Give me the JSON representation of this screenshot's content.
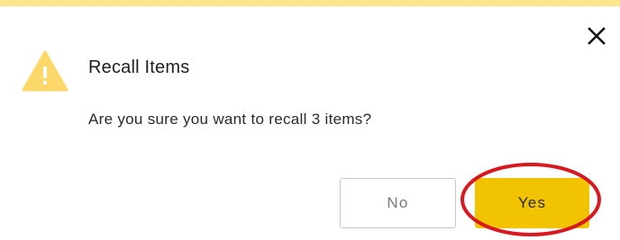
{
  "dialog": {
    "title": "Recall Items",
    "message": "Are you sure you want to recall 3 items?",
    "buttons": {
      "no_label": "No",
      "yes_label": "Yes"
    },
    "icons": {
      "close": "close-icon",
      "warning": "warning-icon"
    },
    "colors": {
      "top_bar": "#fce68a",
      "warning": "#fcd86a",
      "primary_button": "#f2c300",
      "highlight": "#d81920"
    }
  }
}
